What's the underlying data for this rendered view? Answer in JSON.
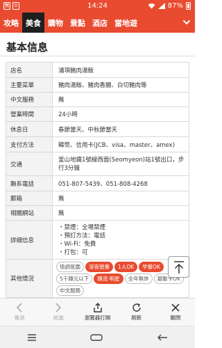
{
  "status": {
    "time": "14:24",
    "battery": "87%",
    "app_icon_1": "無",
    "app_icon_2": "0"
  },
  "nav": {
    "tabs": [
      {
        "label": "攻略"
      },
      {
        "label": "美食",
        "active": true
      },
      {
        "label": "購物"
      },
      {
        "label": "景點"
      },
      {
        "label": "酒店"
      },
      {
        "label": "當地遊"
      }
    ]
  },
  "section_title": "基本信息",
  "info": {
    "rows": [
      {
        "key": "店名",
        "value": "浦項豬肉湯飯"
      },
      {
        "key": "主要菜單",
        "value": "豬肉湯飯、豬肉香腸、白切豬肉等"
      },
      {
        "key": "中文服務",
        "value": "無"
      },
      {
        "key": "營業時間",
        "value": "24小時"
      },
      {
        "key": "休息日",
        "value": "春節當天、中秋節當天"
      },
      {
        "key": "支付方法",
        "value": "韓幣、信用卡(JCB、visa、master、amex)"
      },
      {
        "key": "交通",
        "value": "釜山地鐵1號線西面(Seomyeon)站1號出口，步行3分鐘"
      },
      {
        "key": "聯系電話",
        "value": "051-807-5439、051-808-4268"
      },
      {
        "key": "郵箱",
        "value": "無"
      },
      {
        "key": "相關網站",
        "value": "無"
      },
      {
        "key": "詳細信息",
        "lines": [
          "・禁煙：全場禁煙",
          "・預訂方法：電話",
          "・Wi-Fi：免費",
          "・打包：可"
        ]
      },
      {
        "key": "其他情況",
        "tags": [
          {
            "label": "情調氛圍",
            "hot": false
          },
          {
            "label": "深夜營業",
            "hot": true
          },
          {
            "label": "1人OK",
            "hot": true
          },
          {
            "label": "早餐OK",
            "hot": true
          },
          {
            "label": "5千韓元以下",
            "hot": false
          },
          {
            "label": "韓流·明星",
            "hot": true
          },
          {
            "label": "全年無休",
            "hot": false
          },
          {
            "label": "銀聯卡OK",
            "hot": false
          },
          {
            "label": "中文服務",
            "hot": false
          }
        ]
      }
    ]
  },
  "toolbar": {
    "back": "後退",
    "forward": "前進",
    "open_in_browser": "瀏覽器打開",
    "refresh": "刷新",
    "close": "關閉"
  },
  "colors": {
    "accent": "#e84b2f",
    "active_tab": "#1f1f1f"
  }
}
